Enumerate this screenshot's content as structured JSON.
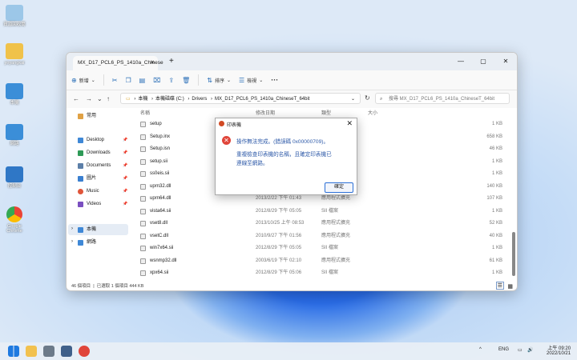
{
  "desktop": [
    {
      "label": "資源回收筒",
      "color": "#9cc7e8"
    },
    {
      "label": "yoyangkai",
      "color": "#f0c24a"
    },
    {
      "label": "本機",
      "color": "#3b8ed8"
    },
    {
      "label": "網路",
      "color": "#3b8ed8"
    },
    {
      "label": "控制台",
      "color": "#2f77c6"
    },
    {
      "label": "Google\nChrome",
      "color": "#ea4335"
    }
  ],
  "explorer": {
    "tab_title": "MX_D17_PCL6_PS_1410a_Chinese",
    "toolbar": {
      "new": "新增",
      "sort": "排序",
      "view": "檢視",
      "more": "···"
    },
    "breadcrumb": [
      "本機",
      "本機磁碟 (C:)",
      "Drivers",
      "MX_D17_PCL6_PS_1410a_ChineseT_64bit"
    ],
    "search_placeholder": "搜尋 MX_D17_PCL6_PS_1410a_ChineseT_64bit",
    "columns": {
      "name": "名稱",
      "date": "修改日期",
      "type": "類型",
      "size": "大小"
    },
    "sidebar": {
      "home": "常用",
      "items": [
        "Desktop",
        "Downloads",
        "Documents",
        "圖片",
        "Music",
        "Videos"
      ],
      "this_pc": "本機",
      "network": "網路"
    },
    "files": [
      {
        "name": "setup",
        "date": "",
        "type": "",
        "size": "1 KB"
      },
      {
        "name": "Setup.inx",
        "date": "",
        "type": "",
        "size": "658 KB"
      },
      {
        "name": "Setup.isn",
        "date": "",
        "type": "",
        "size": "46 KB"
      },
      {
        "name": "setup.sii",
        "date": "",
        "type": "",
        "size": "1 KB"
      },
      {
        "name": "ss0eis.sii",
        "date": "",
        "type": "",
        "size": "1 KB"
      },
      {
        "name": "uprn32.dll",
        "date": "",
        "type": "",
        "size": "140 KB"
      },
      {
        "name": "uprn64.dll",
        "date": "2013/2/22 下午 01:43",
        "type": "應用程式擴充",
        "size": "107 KB"
      },
      {
        "name": "vista64.sii",
        "date": "2012/8/29 下午 05:05",
        "type": "SII 檔案",
        "size": "1 KB"
      },
      {
        "name": "vset8.dll",
        "date": "2013/10/25 上午 08:53",
        "type": "應用程式擴充",
        "size": "52 KB"
      },
      {
        "name": "vsetC.dll",
        "date": "2010/9/27 下午 01:56",
        "type": "應用程式擴充",
        "size": "40 KB"
      },
      {
        "name": "win7x64.sii",
        "date": "2012/8/29 下午 05:05",
        "type": "SII 檔案",
        "size": "1 KB"
      },
      {
        "name": "wsnmp32.dll",
        "date": "2003/6/19 下午 02:10",
        "type": "應用程式擴充",
        "size": "61 KB"
      },
      {
        "name": "xpx64.sii",
        "date": "2012/8/29 下午 05:06",
        "type": "SII 檔案",
        "size": "1 KB"
      }
    ],
    "status": {
      "count": "46 個項目",
      "selected": "已選取 1 個項目  444 KB"
    }
  },
  "dialog": {
    "title": "印表機",
    "line1": "操作無法完成。(錯誤碼 0x00000709)。",
    "line2": "重複檢查印表機的名稱，且確定印表機已",
    "line3": "連線至網路。",
    "ok": "確定"
  },
  "taskbar": {
    "lang": "ENG",
    "time": "上午 09:20",
    "date": "2022/10/21"
  }
}
